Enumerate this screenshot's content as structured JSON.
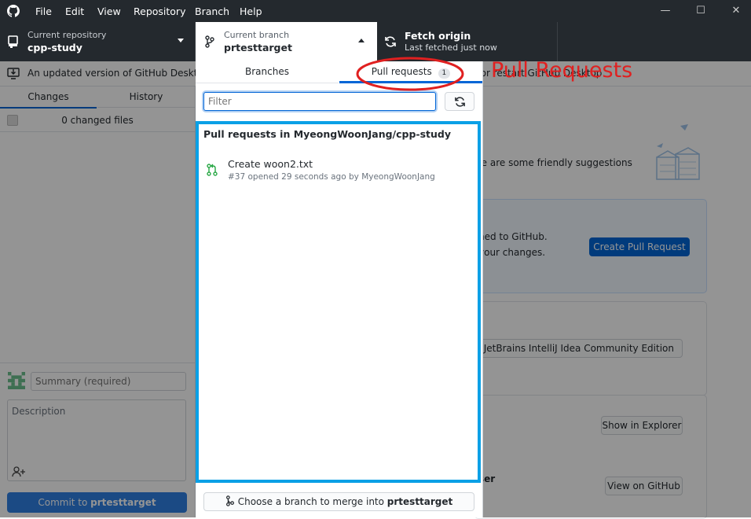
{
  "menu": [
    "File",
    "Edit",
    "View",
    "Repository",
    "Branch",
    "Help"
  ],
  "window_controls": {
    "minimize": "—",
    "maximize": "☐",
    "close": "✕"
  },
  "toolbar": {
    "repo_label": "Current repository",
    "repo_name": "cpp-study",
    "branch_label": "Current branch",
    "branch_name": "prtesttarget",
    "fetch_title": "Fetch origin",
    "fetch_sub": "Last fetched just now"
  },
  "banner": {
    "text": "An updated version of GitHub Desktop",
    "text_right": "w or restart GitHub Desktop"
  },
  "left_panel": {
    "tabs": [
      "Changes",
      "History"
    ],
    "changed_files": "0 changed files",
    "summary_placeholder": "Summary (required)",
    "description_placeholder": "Description",
    "commit_label": "Commit to ",
    "commit_branch": "prtesttarget"
  },
  "main": {
    "suggestions_text": "re are some friendly suggestions",
    "pr_text1": "hed to GitHub.",
    "pr_text2": "your changes.",
    "create_pr": "Create Pull Request",
    "editor_btn": "en in JetBrains IntelliJ Idea Community Edition",
    "show_explorer": "Show in Explorer",
    "browser_text": "ser",
    "view_github": "View on GitHub"
  },
  "dropdown": {
    "tabs": {
      "branches": "Branches",
      "pull_requests": "Pull requests",
      "count": "1"
    },
    "filter_placeholder": "Filter",
    "list_header": "Pull requests in MyeongWoonJang/cpp-study",
    "items": [
      {
        "title": "Create woon2.txt",
        "meta": "#37 opened 29 seconds ago by MyeongWoonJang"
      }
    ],
    "merge_label": "Choose a branch to merge into ",
    "merge_branch": "prtesttarget"
  },
  "annotation": {
    "label": "Pull Requests",
    "color": "#e02020"
  },
  "colors": {
    "highlight_box": "#0aa0e6",
    "accent": "#0366d6",
    "titlebar": "#24292e",
    "pr_icon": "#28a745"
  }
}
